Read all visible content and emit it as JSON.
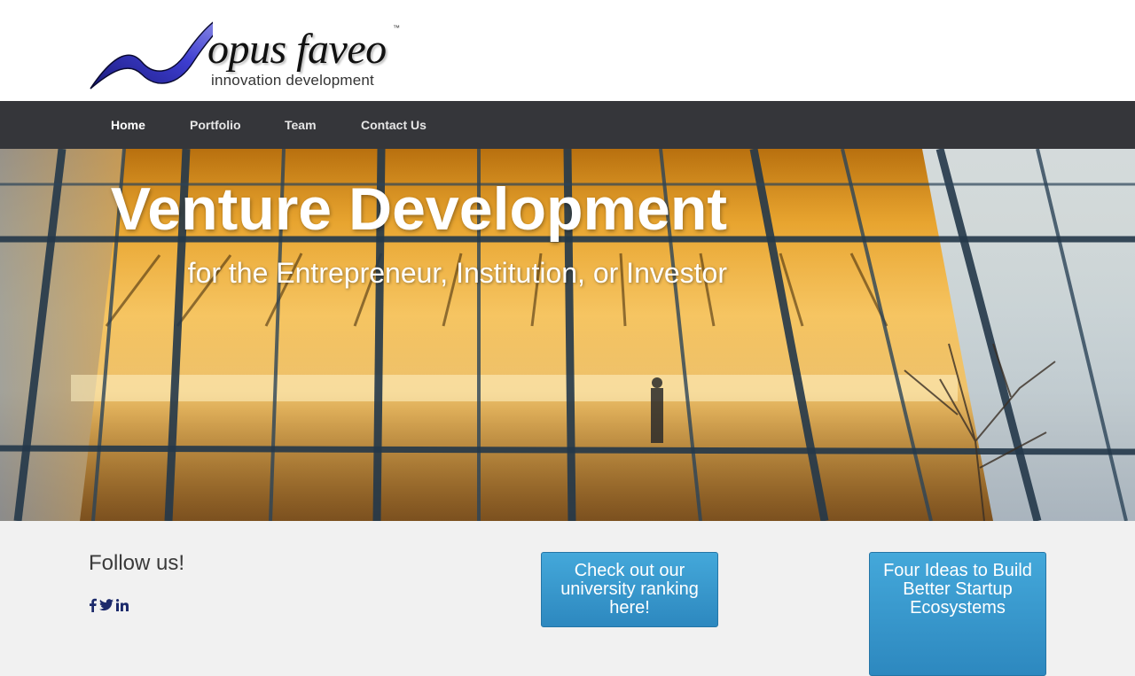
{
  "header": {
    "logo_word": "opus faveo",
    "logo_tagline": "innovation development",
    "logo_tm": "™"
  },
  "nav": {
    "items": [
      {
        "label": "Home",
        "active": true
      },
      {
        "label": "Portfolio",
        "active": false
      },
      {
        "label": "Team",
        "active": false
      },
      {
        "label": "Contact Us",
        "active": false
      }
    ]
  },
  "hero": {
    "title": "Venture Development",
    "subtitle": "for the Entrepreneur, Institution, or Investor"
  },
  "follow": {
    "heading": "Follow us!",
    "icons": [
      "facebook-icon",
      "twitter-icon",
      "linkedin-icon"
    ]
  },
  "cta": {
    "ranking_label": "Check out our university ranking here!",
    "ecosystems_label": "Four Ideas to Build Better Startup Ecosystems"
  },
  "colors": {
    "nav_bg": "#35363a",
    "cta_blue": "#3a9bd0",
    "logo_blue": "#3f3fc4",
    "social_navy": "#1c2a6b"
  }
}
